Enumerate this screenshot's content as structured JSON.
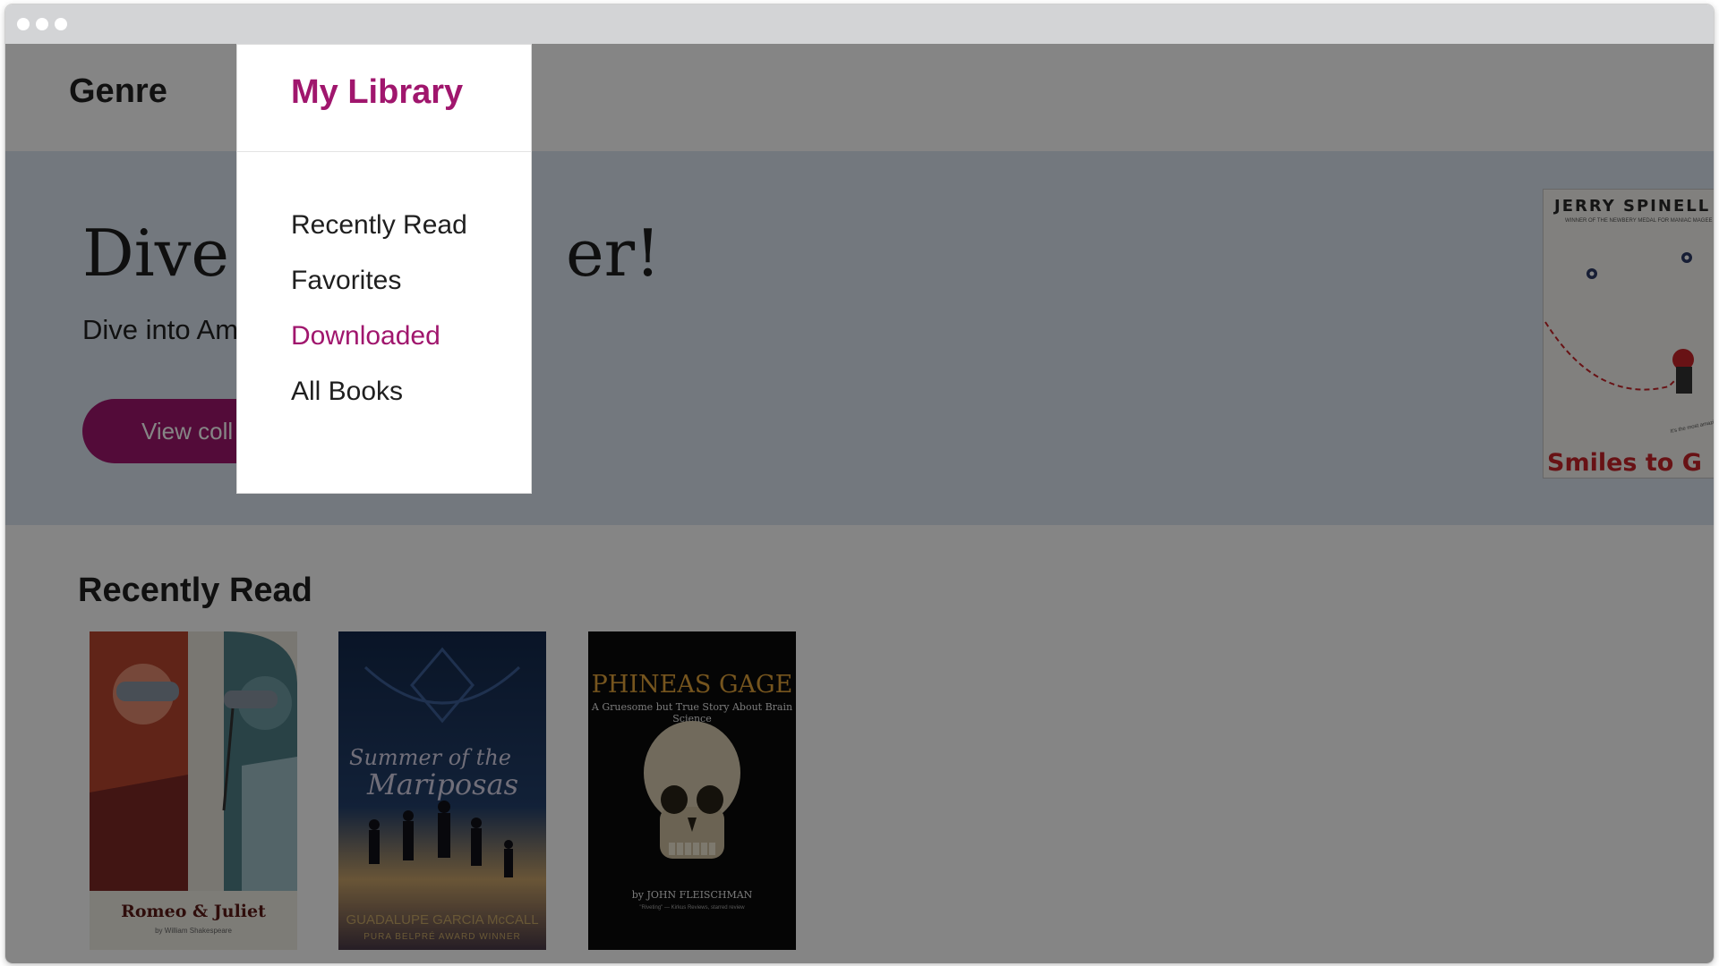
{
  "nav": {
    "genre_label": "Genre",
    "library_label": "My Library"
  },
  "library_menu": {
    "items": [
      {
        "label": "Recently Read",
        "active": false
      },
      {
        "label": "Favorites",
        "active": false
      },
      {
        "label": "Downloaded",
        "active": true
      },
      {
        "label": "All Books",
        "active": false
      }
    ]
  },
  "hero": {
    "title_left": "Dive i",
    "title_right": "er!",
    "subtitle": "Dive into Am",
    "button_label": "View coll",
    "featured_book": {
      "author": "JERRY SPINELL",
      "tagline": "WINNER OF THE NEWBERY MEDAL FOR MANIAC MAGEE",
      "title": "Smiles to G"
    }
  },
  "recently_read": {
    "heading": "Recently Read",
    "books": [
      {
        "title": "Romeo & Juliet",
        "author": "by William Shakespeare"
      },
      {
        "title_line1": "Summer of the",
        "title_line2": "Mariposas",
        "author": "GUADALUPE GARCIA McCALL",
        "award": "PURA BELPRÉ AWARD WINNER"
      },
      {
        "title": "PHINEAS GAGE",
        "subtitle": "A Gruesome but True Story About Brain Science",
        "author": "by JOHN FLEISCHMAN",
        "quote": "\"Riveting\" — Kirkus Reviews, starred review"
      }
    ]
  },
  "colors": {
    "accent": "#a0166d",
    "hero_bg": "#dde6f1",
    "overlay": "rgba(0,0,0,0.48)"
  }
}
